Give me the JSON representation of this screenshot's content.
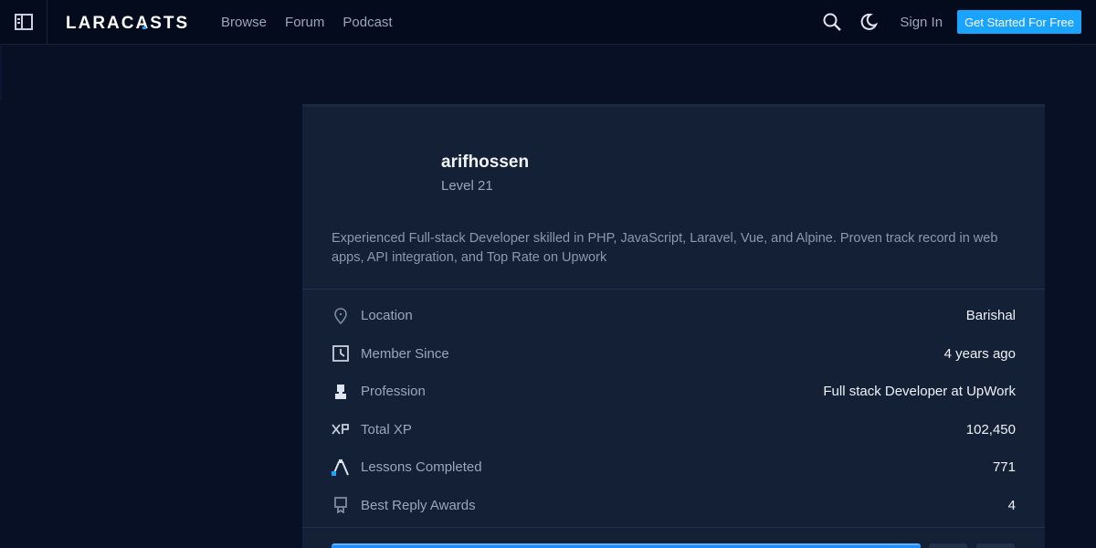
{
  "nav": {
    "logo_text": "LARACASTS",
    "links": [
      "Browse",
      "Forum",
      "Podcast"
    ],
    "sign_in": "Sign In",
    "cta": "Get Started For Free"
  },
  "profile": {
    "username": "arifhossen",
    "level": "Level 21",
    "bio": "Experienced Full-stack Developer skilled in PHP, JavaScript, Laravel, Vue, and Alpine. Proven track record in web apps, API integration, and Top Rate on Upwork",
    "stats": [
      {
        "label": "Location",
        "value": "Barishal",
        "icon": "location-pin-icon"
      },
      {
        "label": "Member Since",
        "value": "4 years ago",
        "icon": "clock-icon"
      },
      {
        "label": "Profession",
        "value": "Full stack Developer at UpWork",
        "icon": "person-icon"
      },
      {
        "label": "Total XP",
        "value": "102,450",
        "icon": "xp-icon"
      },
      {
        "label": "Lessons Completed",
        "value": "771",
        "icon": "lessons-icon"
      },
      {
        "label": "Best Reply Awards",
        "value": "4",
        "icon": "award-icon"
      }
    ]
  },
  "colors": {
    "background": "#071024",
    "card": "#142036",
    "accent": "#1aa3ff"
  }
}
